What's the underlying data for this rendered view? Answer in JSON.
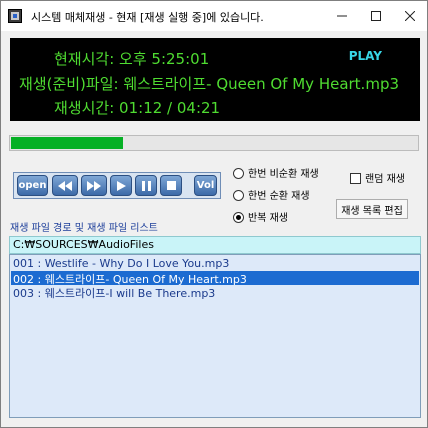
{
  "window": {
    "title": "시스템 매체재생 - 현재 [재생 실행 중]에 있습니다."
  },
  "display": {
    "time_label": "현재시각:",
    "time_value": "오후 5:25:01",
    "file_label": "재생(준비)파일:",
    "file_value": "웨스트라이프- Queen Of My Heart.mp3",
    "elapsed_label": "재생시간:",
    "elapsed_value": "01:12 / 04:21",
    "status": "PLAY",
    "text_color": "#4fdc31",
    "status_color": "#38d6e6"
  },
  "progress": {
    "fraction": 0.276
  },
  "toolbar": {
    "open_label": "open",
    "vol_label": "Vol",
    "buttons": [
      "open-button",
      "rewind-button",
      "fast-forward-button",
      "play-button",
      "pause-button",
      "stop-button",
      "volume-button"
    ]
  },
  "options": {
    "modes": [
      {
        "label": "한번 비순환 재생",
        "selected": false
      },
      {
        "label": "한번 순환 재생",
        "selected": false
      },
      {
        "label": "반복 재생",
        "selected": true
      }
    ],
    "random_label": "랜덤 재생",
    "random_checked": false,
    "edit_label": "재생 목록 편집"
  },
  "playlist": {
    "section_label": "재생 파일 경로 및 재생 파일 리스트",
    "path": "C:₩SOURCES₩AudioFiles",
    "items": [
      {
        "text": "001 :  Westlife - Why Do I Love You.mp3",
        "selected": false
      },
      {
        "text": "002 :  웨스트라이프- Queen Of My Heart.mp3",
        "selected": true
      },
      {
        "text": "003 :  웨스트라이프-I will Be There.mp3",
        "selected": false
      }
    ],
    "selected_color": "#1c6bd1"
  }
}
